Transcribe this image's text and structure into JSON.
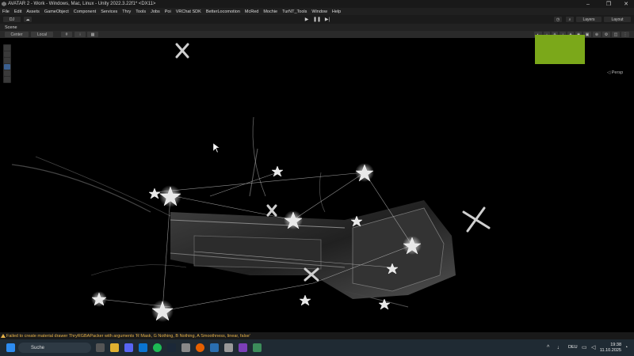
{
  "window": {
    "title": "AVATAR 2 - Work - Windows, Mac, Linux - Unity 2022.3.22f1* <DX11>"
  },
  "menu": {
    "items": [
      "File",
      "Edit",
      "Assets",
      "GameObject",
      "Component",
      "Services",
      "Thry",
      "Tools",
      "Jobs",
      "Poi",
      "VRChat SDK",
      "BetterLocomotion",
      "McRed",
      "Mochie",
      "TurNT_Tools",
      "Window",
      "Help"
    ]
  },
  "toolbar": {
    "account": "DJ",
    "layers": "Layers",
    "layout": "Layout"
  },
  "scene": {
    "tab": "Scene",
    "pivot": "Center",
    "space": "Local",
    "projection": "Persp"
  },
  "status": {
    "message": "Failed to create material drawer ThryRGBAPacker with arguments 'R Mask, G Nothing, B Nothing, A Smoothness, linear, false'"
  },
  "taskbar": {
    "search_placeholder": "Suche",
    "language": "DEU",
    "time": "19:38",
    "date": "11.10.2025"
  }
}
